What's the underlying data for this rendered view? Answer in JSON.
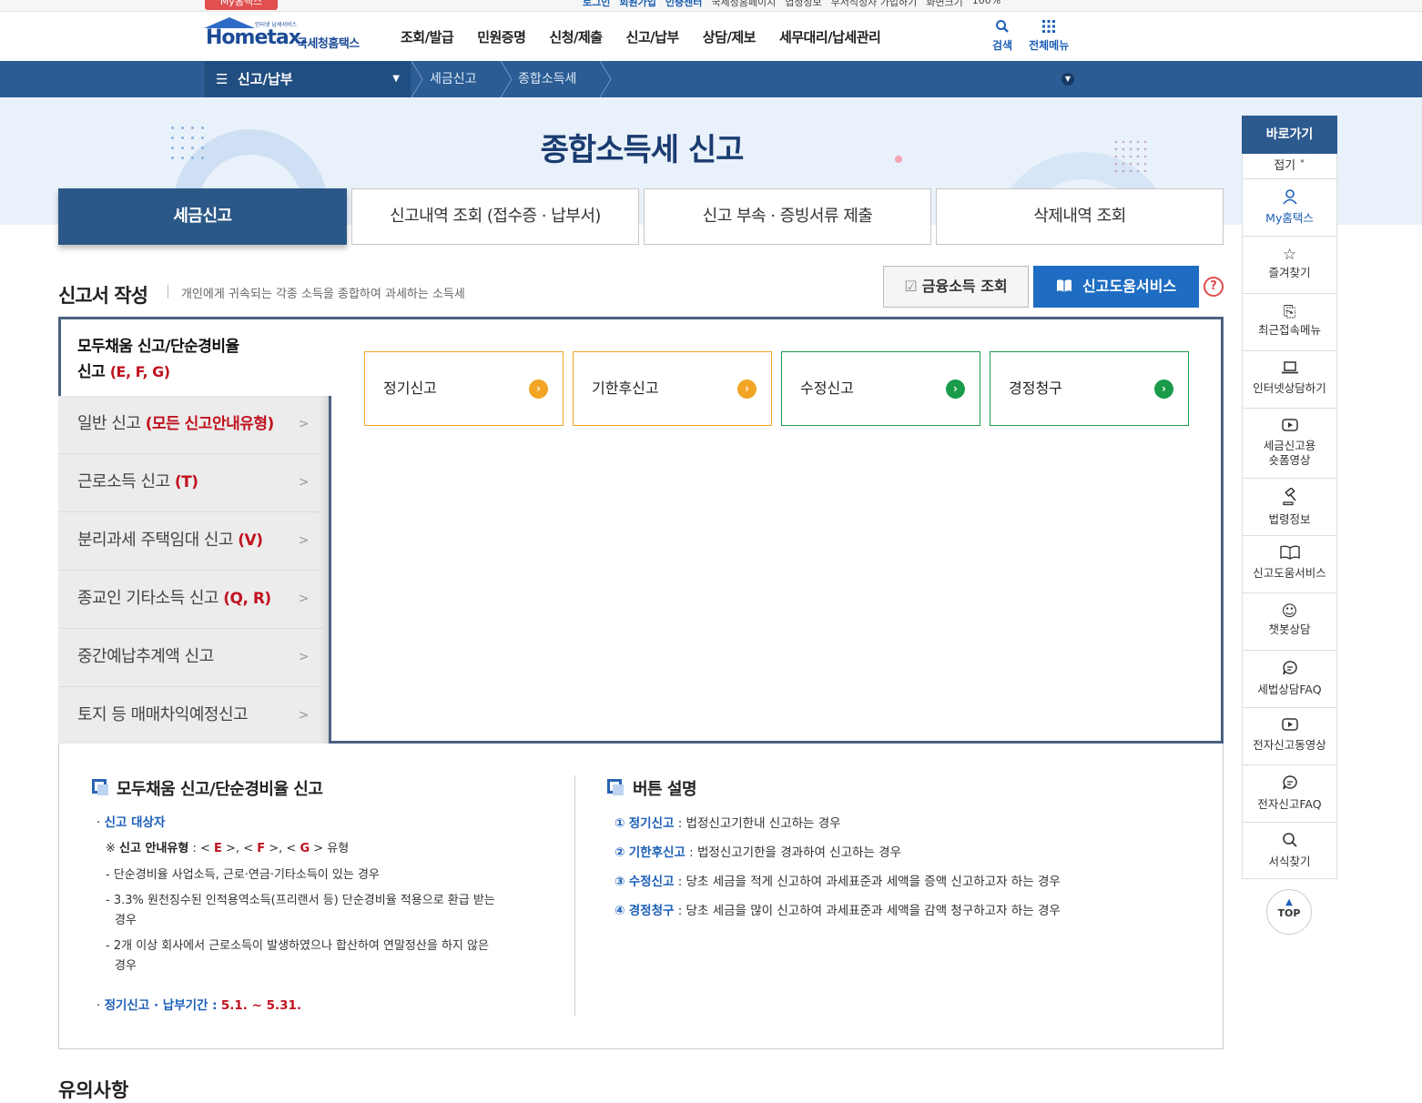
{
  "util": {
    "mytab": "My홈택스",
    "links": [
      "로그인",
      "회원가입",
      "인증센터",
      "국세청홈페이지",
      "엽청정보",
      "부서직정자 가입하기",
      "화면크기",
      "100%"
    ]
  },
  "header": {
    "logo_word": "Hometax.",
    "logo_kor": "국세청홈택스",
    "logo_tiny": "인터넷 납세서비스",
    "gnb": [
      "조회/발급",
      "민원증명",
      "신청/제출",
      "신고/납부",
      "상담/제보",
      "세무대리/납세관리"
    ],
    "search_label": "검색",
    "search_icon": "search-icon",
    "allmenu_label": "전체메뉴",
    "allmenu_icon": "grid-icon"
  },
  "breadcrumb": {
    "main": "신고/납부",
    "items": [
      "세금신고",
      "종합소득세"
    ]
  },
  "hero": {
    "title": "종합소득세 신고"
  },
  "tabs": [
    {
      "label": "세금신고",
      "active": true
    },
    {
      "label": "신고내역 조회 (접수증 · 납부서)"
    },
    {
      "label": "신고 부속 · 증빙서류 제출"
    },
    {
      "label": "삭제내역 조회"
    }
  ],
  "section": {
    "title": "신고서 작성",
    "desc": "개인에게 귀속되는 각종 소득을 종합하여 과세하는 소득세",
    "fin_button": "금융소득 조회",
    "help_button": "신고도움서비스",
    "question": "?"
  },
  "side_active": {
    "line1": "모두채움 신고/단순경비율",
    "line2": "신고",
    "code": "(E, F, G)"
  },
  "side_items": [
    {
      "label": "일반 신고",
      "code": "(모든 신고안내유형)"
    },
    {
      "label": "근로소득 신고",
      "code": "(T)"
    },
    {
      "label": "분리과세 주택임대 신고",
      "code": "(V)"
    },
    {
      "label": "종교인 기타소득 신고",
      "code": "(Q, R)"
    },
    {
      "label": "중간예납추계액 신고",
      "code": ""
    },
    {
      "label": "토지 등 매매차익예정신고",
      "code": ""
    }
  ],
  "options": [
    "정기신고",
    "기한후신고",
    "수정신고",
    "경정청구"
  ],
  "info": {
    "left_title": "모두채움 신고/단순경비율 신고",
    "target_label": "신고 대상자",
    "note_prefix": "※",
    "note_key": "신고 안내유형",
    "note_mid": ": <",
    "codes": [
      "E",
      "F",
      "G"
    ],
    "note_suffix": "> 유형",
    "bullets": [
      "단순경비율 사업소득, 근로·연금·기타소득이 있는 경우",
      "3.3% 원천징수된 인적용역소득(프리랜서 등) 단순경비율 적용으로 환급 받는",
      "경우",
      "2개 이상 회사에서 근로소득이 발생하였으나 합산하여 연말정산을 하지 않은",
      "경우"
    ],
    "period_label": "정기신고 · 납부기간 :",
    "period_value": "5.1. ~ 5.31.",
    "right_title": "버튼 설명",
    "explain": [
      {
        "num": "①",
        "name": "정기신고",
        "text": ": 법정신고기한내 신고하는 경우"
      },
      {
        "num": "②",
        "name": "기한후신고",
        "text": ": 법정신고기한을 경과하여 신고하는 경우"
      },
      {
        "num": "③",
        "name": "수정신고",
        "text": ": 당초 세금을 적게 신고하여 과세표준과 세액을 증액 신고하고자 하는 경우"
      },
      {
        "num": "④",
        "name": "경정청구",
        "text": ": 당초 세금을 많이 신고하여 과세표준과 세액을 감액 청구하고자 하는 경우"
      }
    ]
  },
  "quick": {
    "head": "바로가기",
    "fold": "접기",
    "items": [
      {
        "label": "My홈택스",
        "icon": "user-icon"
      },
      {
        "label": "즐겨찾기",
        "icon": "star-icon"
      },
      {
        "label": "최근접속메뉴",
        "icon": "recent-icon"
      },
      {
        "label": "인터넷상담하기",
        "icon": "laptop-icon"
      },
      {
        "label": "세금신고용",
        "label2": "숏폼영상",
        "icon": "video-icon"
      },
      {
        "label": "법령정보",
        "icon": "gavel-icon"
      },
      {
        "label": "신고도움서비스",
        "icon": "book-icon"
      },
      {
        "label": "챗봇상담",
        "icon": "chatbot-icon"
      },
      {
        "label": "세법상담FAQ",
        "icon": "chat-icon"
      },
      {
        "label": "전자신고동영상",
        "icon": "video-icon"
      },
      {
        "label": "전자신고FAQ",
        "icon": "chat-icon"
      },
      {
        "label": "서식찾기",
        "icon": "search-icon"
      }
    ],
    "top": "TOP"
  },
  "bottom": {
    "title": "유의사항"
  },
  "colors": {
    "navy": "#2b5887",
    "accent_blue": "#1f6dc3",
    "orange": "#f1a523",
    "green": "#1a9b4a",
    "red": "#c1121f"
  }
}
